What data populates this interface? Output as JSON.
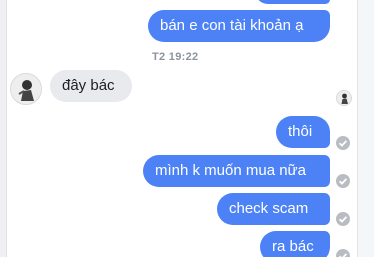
{
  "timestamp": "T2 19:22",
  "messages": [
    {
      "side": "out",
      "text": "bán e con tài khoản ạ"
    },
    {
      "side": "in",
      "text": "đây bác"
    },
    {
      "side": "out",
      "text": "thôi"
    },
    {
      "side": "out",
      "text": "mình k muốn mua nữa"
    },
    {
      "side": "out",
      "text": "check scam"
    },
    {
      "side": "out",
      "text": "ra bác"
    }
  ],
  "colors": {
    "outgoing_bubble": "#4c82f6",
    "incoming_bubble": "#e9eaee",
    "seen_tick": "#b9bdc3"
  },
  "icons": {
    "sender_avatar": "user-avatar-icon",
    "seen_avatar": "seen-avatar-icon",
    "delivered": "check-circle-icon"
  }
}
